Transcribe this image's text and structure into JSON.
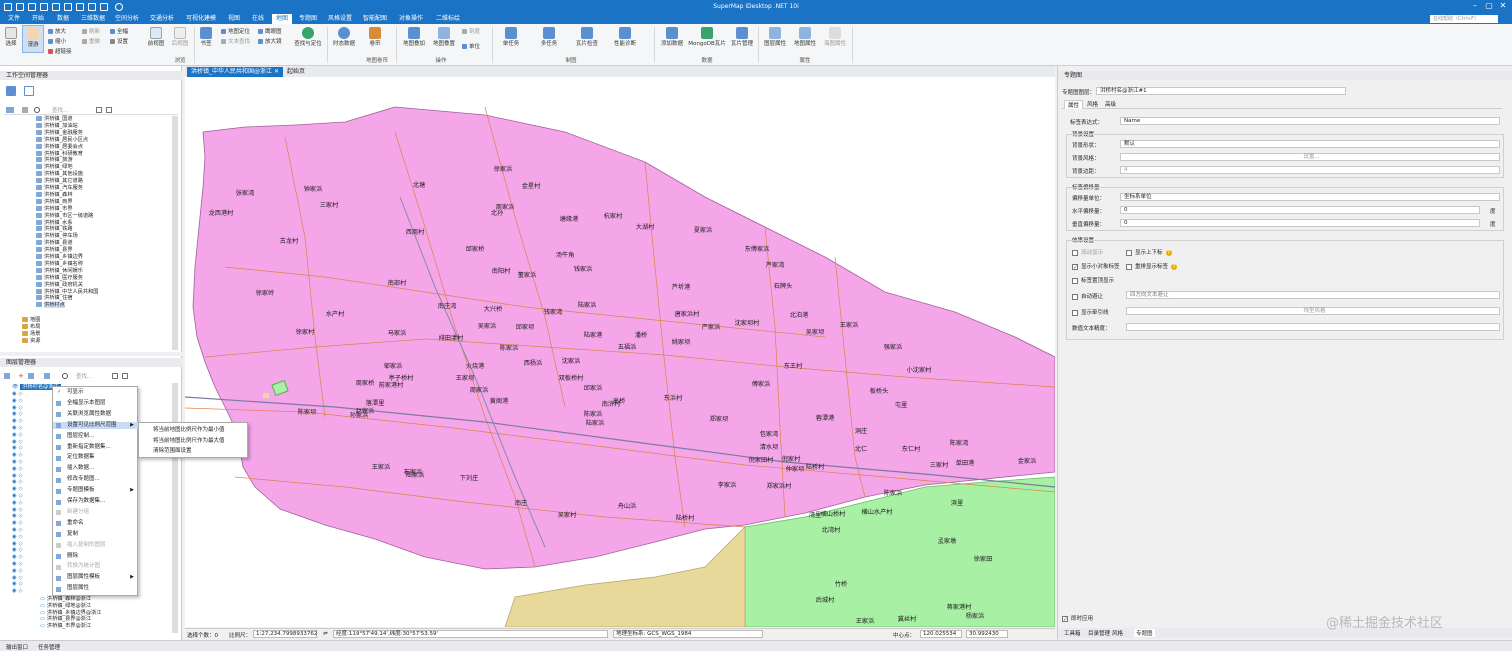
{
  "app": {
    "title": "SuperMap iDesktop .NET 10i",
    "search_placeholder": "在线帮助（Ctrl+F）"
  },
  "menu_tabs": [
    "文件",
    "开始",
    "数据",
    "三维数据",
    "空间分析",
    "交通分析",
    "可视化建模",
    "视图",
    "在线",
    "地图",
    "专题图",
    "风格设置",
    "智能配图",
    "对象操作",
    "二维标绘"
  ],
  "active_menu_tab": "地图",
  "ribbon": {
    "browse": {
      "group_label": "浏览",
      "select": "选择",
      "pan": "漫游",
      "zoom_in": "放大",
      "zoom_out": "缩小",
      "hyperlink": "超链接",
      "refresh": "刷新",
      "redo": "重做",
      "full_extent": "全幅",
      "settings": "设置",
      "prev_view": "前视图",
      "next_view": "后视图"
    },
    "bookmark": {
      "bookmark": "书签",
      "locate": "地图定位",
      "text_search": "文本查找",
      "magnifier": "放大镜",
      "eagle_eye": "鹰眼图",
      "query_locate": "查找与定位"
    },
    "scroll": {
      "group_label": "地图卷帘",
      "temporal": "时态数据",
      "swipe": "卷帘"
    },
    "ops": {
      "group_label": "操作",
      "overlay": "地图叠加",
      "shift": "地图叠置",
      "unit": "单位",
      "rate": "刻度"
    },
    "tiles": {
      "group_label": "制图",
      "single_task": "单任务",
      "multi_task": "多任务",
      "tile_check": "瓦片检查",
      "perf": "性能诊断"
    },
    "data": {
      "group_label": "数据",
      "add": "添加数据",
      "mongodb": "MongoDB瓦片",
      "tile_manage": "瓦片管理"
    },
    "props": {
      "group_label": "属性",
      "layer_props": "图层属性",
      "map_props": "地图属性",
      "map_prop2": "海图属性"
    }
  },
  "workspace": {
    "title": "工作空间管理器",
    "search_placeholder": "查找...",
    "items": [
      "洪桥镇_国道",
      "洪桥镇_加油站",
      "洪桥镇_金融服务",
      "洪桥镇_居民小区点",
      "洪桥镇_居委会点",
      "洪桥镇_科研教育",
      "洪桥镇_旅游",
      "洪桥镇_绿地",
      "洪桥镇_其他设施",
      "洪桥镇_其它道路",
      "洪桥镇_汽车服务",
      "洪桥镇_森林",
      "洪桥镇_商界",
      "洪桥镇_市界",
      "洪桥镇_市区一级道路",
      "洪桥镇_水系",
      "洪桥镇_铁路",
      "洪桥镇_停车场",
      "洪桥镇_县道",
      "洪桥镇_县界",
      "洪桥镇_乡镇边界",
      "洪桥镇_乡镇名称",
      "洪桥镇_休闲娱乐",
      "洪桥镇_医疗服务",
      "洪桥镇_政府机关",
      "洪桥镇_中华人民共和国",
      "洪桥镇_住宿",
      "洪桥村点"
    ],
    "roots": [
      "地图",
      "布局",
      "场景",
      "资源"
    ]
  },
  "layers": {
    "title": "图层管理器",
    "search_placeholder": "查找...",
    "selected": "洪桥村名@浙江",
    "bottom_items": [
      "洪桥镇_森林@浙江",
      "洪桥镇_绿地@浙江",
      "洪桥镇_乡镇边界@浙江",
      "洪桥镇_县界@浙江",
      "洪桥镇_市界@浙江"
    ]
  },
  "context_menu": {
    "items": [
      {
        "label": "可显示",
        "type": "check"
      },
      {
        "label": "全幅显示本图层",
        "type": "normal"
      },
      {
        "label": "关联浏览属性数据",
        "type": "normal"
      },
      {
        "label": "设置可见比例尺范围",
        "type": "submenu",
        "highlight": true
      },
      {
        "label": "图层控制...",
        "type": "normal"
      },
      {
        "label": "重新指定数据集...",
        "type": "normal"
      },
      {
        "label": "定位数据集",
        "type": "normal"
      },
      {
        "label": "插入数据...",
        "type": "normal"
      },
      {
        "label": "修改专题图...",
        "type": "normal"
      },
      {
        "label": "专题图模板",
        "type": "submenu"
      },
      {
        "label": "保存为数据集...",
        "type": "normal"
      },
      {
        "label": "新建分组",
        "type": "disabled"
      },
      {
        "label": "重命名",
        "type": "normal"
      },
      {
        "label": "复制",
        "type": "normal"
      },
      {
        "label": "插入复制的图层",
        "type": "disabled"
      },
      {
        "label": "删除",
        "type": "normal"
      },
      {
        "label": "转换为统计图",
        "type": "disabled"
      },
      {
        "label": "图层属性模板",
        "type": "submenu"
      },
      {
        "label": "图层属性",
        "type": "normal"
      }
    ],
    "submenu": [
      "将当前地图比例尺作为最小值",
      "将当前地图比例尺作为最大值",
      "清除范围面设置"
    ]
  },
  "map": {
    "tabs": [
      "洪桥镇_中华人民共和国@浙江",
      "起始页"
    ],
    "labels": [
      "徐家浜",
      "金星村",
      "张家湾",
      "钟家浜",
      "北塘",
      "龙西港村",
      "三家村",
      "周家浜",
      "北孙",
      "塘缘港",
      "杭家村",
      "大湖村",
      "西周村",
      "夏家浜",
      "古龙村",
      "邱家桥",
      "汤牛角",
      "钱家浜",
      "东傅家浜",
      "芦家湾",
      "南部村",
      "南阳村",
      "董家浜",
      "芦圻港",
      "徐家岭",
      "水产村",
      "南庄湾",
      "钱家湾",
      "石牌头",
      "陆家浜",
      "大兴桥",
      "北泊港",
      "陆家港",
      "马家浜",
      "吴家浜",
      "邱家坝",
      "徐家村",
      "唐家浜村",
      "严家浜",
      "沈家坝村",
      "王家浜",
      "吴家坝",
      "陈家浜",
      "排田漾村",
      "五福浜",
      "潘桥",
      "姚家坝",
      "强家浜",
      "小沈家村",
      "邹家浜",
      "亭子桥村",
      "火烧港",
      "西杨浜",
      "沈家浜",
      "东王村",
      "傅家浜",
      "板桥头",
      "王家坝",
      "前家港村",
      "双板桥村",
      "周家桥",
      "邱家浜",
      "落潭里",
      "屯里",
      "孙家浜",
      "陈家坝",
      "周家浜",
      "高桥",
      "南浒村",
      "黄阁港",
      "东浜村",
      "郑家坝",
      "赵家浜",
      "陈家浜",
      "陆家浜",
      "蓉潭港",
      "洞庄",
      "包家湾",
      "清水坝",
      "陈家湾",
      "倪家村",
      "北仁",
      "东仁村",
      "三家村",
      "单田港",
      "金家浜",
      "陆家浜",
      "王家浜",
      "石家浜",
      "下刘庄",
      "倪家田村",
      "仲家坝",
      "南庄",
      "陆桥村",
      "李家浜",
      "郑家浜村",
      "横山桥村",
      "横山水产村",
      "湾里",
      "吴家村",
      "舟山浜",
      "陆桥村",
      "北湾村",
      "陈家浜",
      "滨里",
      "孟家墩",
      "徐家田",
      "竹桥",
      "后城村",
      "王家浜",
      "蒋家港村",
      "杨家浜",
      "冀丝村"
    ]
  },
  "thematic": {
    "title": "专题图",
    "layer_label": "专题图图层：",
    "layer_value": "洪桥村名@浙江#1",
    "tabs": [
      "属性",
      "风格",
      "高级"
    ],
    "field_expr_label": "标签表达式：",
    "field_expr_value": "Name",
    "bg_group": "背景设置",
    "bg_shape_label": "背景形状：",
    "bg_shape_value": "默认",
    "bg_style_label": "背景风格：",
    "bg_style_btn": "设置...",
    "bg_margin_label": "背景边距：",
    "bg_margin_value": "4",
    "offset_group": "标签偏移量",
    "offset_unit_label": "偏移量单位：",
    "offset_unit_value": "坐标系单位",
    "offset_x_label": "水平偏移量：",
    "offset_x_value": "0",
    "offset_y_label": "垂直偏移量：",
    "offset_y_value": "0",
    "deg": "度",
    "effect_group": "效果设置",
    "flow": "流动显示",
    "show_updown": "显示上下标",
    "small_label": "显示小对象标签",
    "overlap": "重排显示标签",
    "top": "标签置顶显示",
    "auto_avoid": "自动避让",
    "avoid_value": "四方向文本避让",
    "leader": "显示牵引线",
    "line_style": "线型风格",
    "align_label": "数值文本精度：",
    "instant": "即时应用",
    "bottom_tabs": [
      "工具箱",
      "目录管理",
      "风格",
      "专题图"
    ]
  },
  "status": {
    "selected_label": "选择个数：0",
    "scale_label": "比例尺：",
    "scale_value": "1:27,234.7998933762",
    "coord_label": "经度:119°57'49.14',纬度:30°57'53.59'",
    "crs_label": "地理坐标系: GCS_WGS_1984",
    "center_label": "中心点：",
    "center_x": "120.025534",
    "center_y": "30.992430"
  },
  "bottom_bar": [
    "输出窗口",
    "任务管理"
  ],
  "watermark": "@稀土掘金技术社区",
  "colors": {
    "accent": "#1a73c5",
    "district": "#f4a6e9",
    "green": "#a8f0a4",
    "khaki": "#e8d99a"
  }
}
